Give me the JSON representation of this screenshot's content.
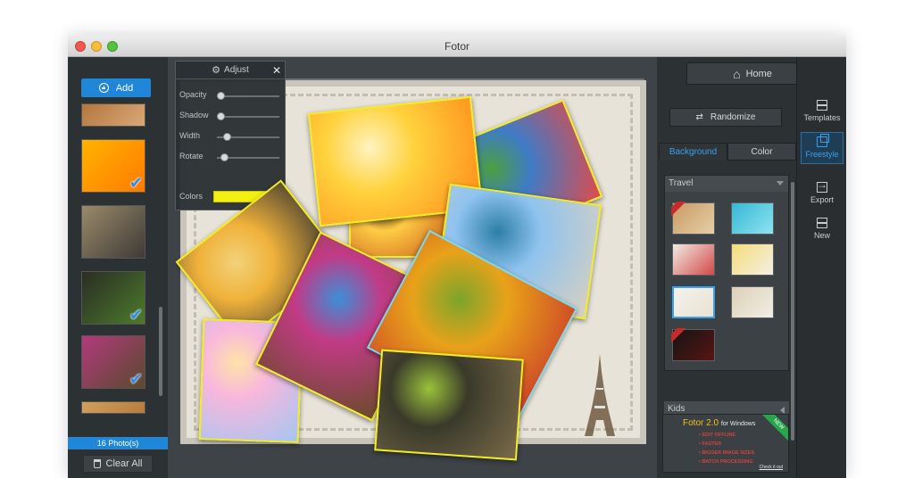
{
  "window": {
    "title": "Fotor"
  },
  "left": {
    "add_label": "Add",
    "photo_count": "16 Photo(s)",
    "clear_label": "Clear All",
    "thumbs": [
      {
        "colors": [
          "#b5763e",
          "#d8a878"
        ],
        "checked": false
      },
      {
        "colors": [
          "#ffb300",
          "#ff7a00"
        ],
        "checked": true
      },
      {
        "colors": [
          "#9a8a6a",
          "#3e3a36"
        ],
        "checked": false
      },
      {
        "colors": [
          "#2a2d23",
          "#4c7a2c"
        ],
        "checked": true
      },
      {
        "colors": [
          "#b23a7c",
          "#5a4a2e"
        ],
        "checked": true
      },
      {
        "colors": [
          "#d1a15c",
          "#b87b39"
        ],
        "checked": false
      }
    ]
  },
  "adjust": {
    "title": "Adjust",
    "rows": [
      {
        "label": "Opacity",
        "value": 0.0
      },
      {
        "label": "Shadow",
        "value": 0.0
      },
      {
        "label": "Width",
        "value": 0.1
      },
      {
        "label": "Rotate",
        "value": 0.05
      }
    ],
    "colors_label": "Colors",
    "color": "#f2f010"
  },
  "collage": {
    "photos": [
      {
        "name": "photo-sunset-woman",
        "colors": [
          "#ffd23d",
          "#ff8a1a",
          "#fff3c0"
        ],
        "sel": false
      },
      {
        "name": "photo-beach-houses",
        "colors": [
          "#3e7bc6",
          "#e04b4b",
          "#4c9f3f"
        ],
        "sel": false
      },
      {
        "name": "photo-venice",
        "colors": [
          "#8fc3ef",
          "#d8d0c0",
          "#2c7fa8"
        ],
        "sel": false
      },
      {
        "name": "photo-beach-yoga",
        "colors": [
          "#f0b23a",
          "#303030",
          "#f2d27a"
        ],
        "sel": false
      },
      {
        "name": "photo-flowers-street",
        "colors": [
          "#c23a86",
          "#6a4b2a",
          "#3c8fd8"
        ],
        "sel": false
      },
      {
        "name": "photo-autumn-tree",
        "colors": [
          "#e8a21a",
          "#c8342a",
          "#7aa52c"
        ],
        "sel": true
      },
      {
        "name": "photo-bokeh",
        "colors": [
          "#f8b7dc",
          "#a4c6f2",
          "#ffe3a8"
        ],
        "sel": false
      },
      {
        "name": "photo-motocross",
        "colors": [
          "#3a3a2a",
          "#7a6a4a",
          "#9ac23a"
        ],
        "sel": false
      },
      {
        "name": "photo-woman-window",
        "colors": [
          "#ffcc44",
          "#c65a1a",
          "#2c1a10"
        ],
        "sel": false
      }
    ]
  },
  "right": {
    "home_label": "Home",
    "randomize_label": "Randomize",
    "tabs": [
      {
        "label": "Background",
        "active": true
      },
      {
        "label": "Color",
        "active": false
      }
    ],
    "section_travel": "Travel",
    "section_kids": "Kids",
    "backgrounds": [
      {
        "colors": [
          "#c89a66",
          "#e7cfa6"
        ],
        "new": true,
        "sel": false
      },
      {
        "colors": [
          "#37b7d5",
          "#8fe3ef"
        ],
        "new": false,
        "sel": false
      },
      {
        "colors": [
          "#f1ece2",
          "#d24a4a"
        ],
        "new": false,
        "sel": false
      },
      {
        "colors": [
          "#f4dc7a",
          "#f3f0e4"
        ],
        "new": false,
        "sel": false
      },
      {
        "colors": [
          "#f4f2ec",
          "#e8e2d2"
        ],
        "new": false,
        "sel": true
      },
      {
        "colors": [
          "#dcd0b6",
          "#f2eee6"
        ],
        "new": false,
        "sel": false
      },
      {
        "colors": [
          "#141414",
          "#5a1414"
        ],
        "new": true,
        "sel": false
      }
    ],
    "ad": {
      "title": "Fotor 2.0",
      "for": "for Windows",
      "badge": "NEW",
      "items": [
        "EDIT OFFLINE",
        "FASTER",
        "BIGGER IMAGE SIZES",
        "BATCH PROCESSING"
      ],
      "link": "Check it out"
    }
  },
  "toolbar": {
    "items": [
      {
        "label": "Templates",
        "icon": "templates",
        "active": false
      },
      {
        "label": "Freestyle",
        "icon": "freestyle",
        "active": true
      },
      {
        "label": "Export",
        "icon": "export",
        "active": false
      },
      {
        "label": "New",
        "icon": "new",
        "active": false
      }
    ]
  }
}
